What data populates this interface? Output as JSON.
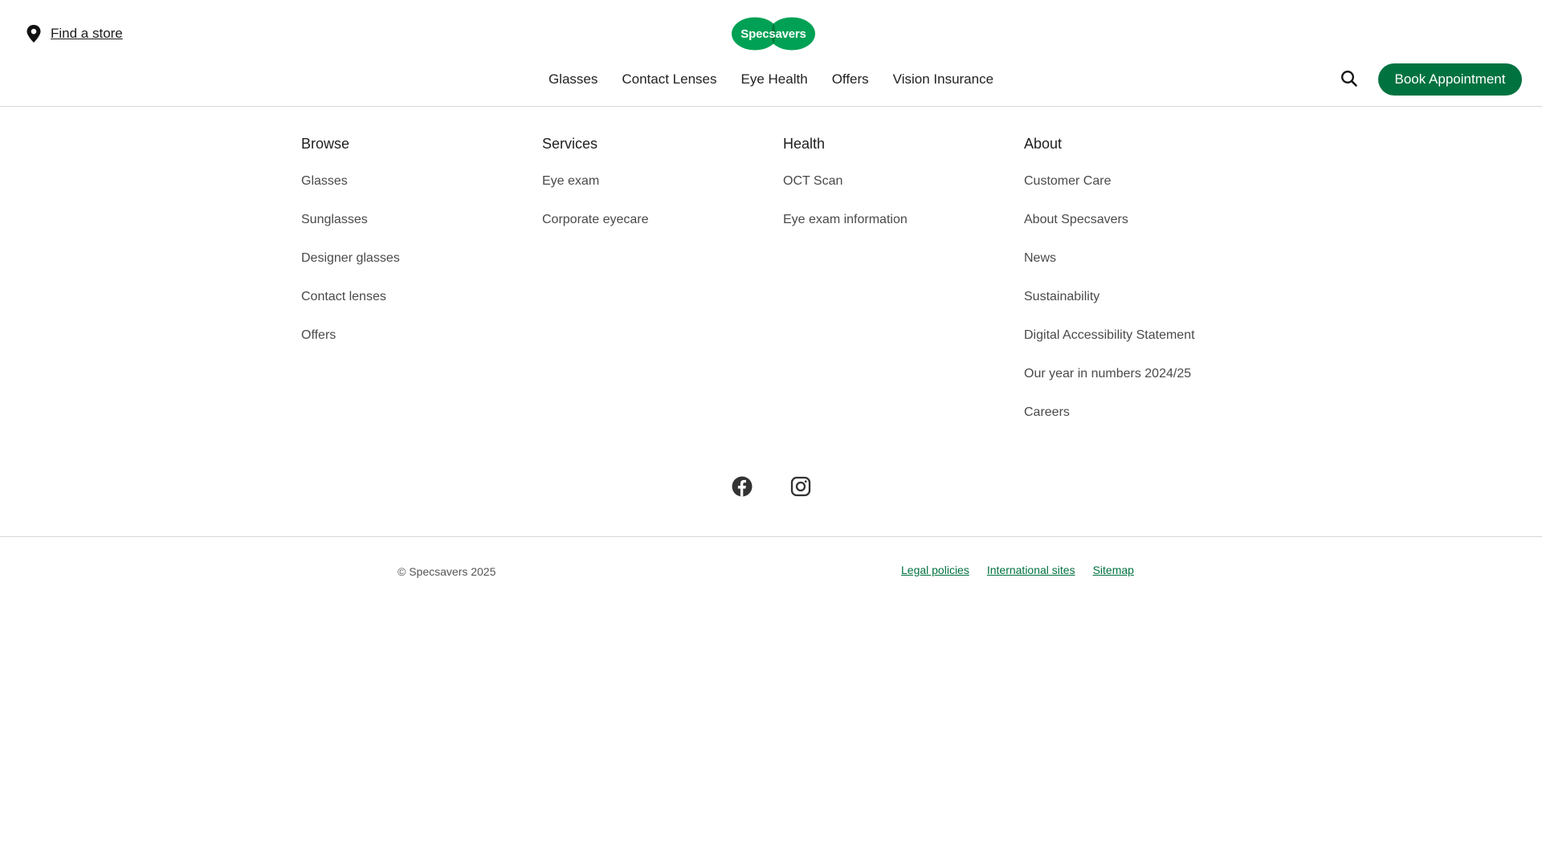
{
  "header": {
    "find_store_label": "Find a store",
    "logo_text": "Specsavers",
    "nav": [
      {
        "label": "Glasses"
      },
      {
        "label": "Contact Lenses"
      },
      {
        "label": "Eye Health"
      },
      {
        "label": "Offers"
      },
      {
        "label": "Vision Insurance"
      }
    ],
    "book_label": "Book Appointment",
    "icons": {
      "location": "map-pin-icon",
      "search": "search-icon"
    }
  },
  "footer": {
    "columns": [
      {
        "title": "Browse",
        "links": [
          "Glasses",
          "Sunglasses",
          "Designer glasses",
          "Contact lenses",
          "Offers"
        ]
      },
      {
        "title": "Services",
        "links": [
          "Eye exam",
          "Corporate eyecare"
        ]
      },
      {
        "title": "Health",
        "links": [
          "OCT Scan",
          "Eye exam information"
        ]
      },
      {
        "title": "About",
        "links": [
          "Customer Care",
          "About Specsavers",
          "News",
          "Sustainability",
          "Digital Accessibility Statement",
          "Our year in numbers 2024/25",
          "Careers"
        ]
      }
    ],
    "social": [
      "facebook-icon",
      "instagram-icon"
    ],
    "copyright": "© Specsavers 2025",
    "legal_links": [
      "Legal policies",
      "International sites",
      "Sitemap"
    ]
  },
  "colors": {
    "brand_green": "#007240",
    "text": "#333333",
    "divider": "#d6d6d6"
  }
}
